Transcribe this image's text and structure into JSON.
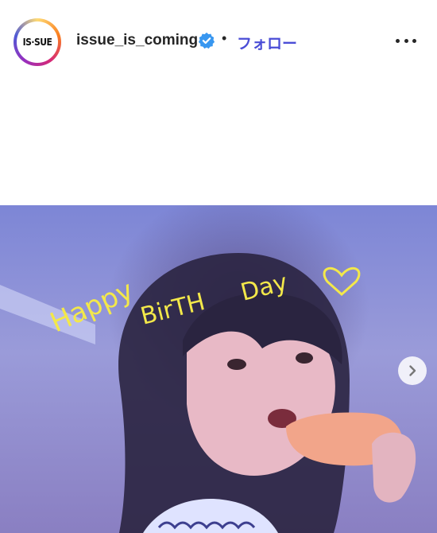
{
  "post": {
    "username": "issue_is_coming",
    "follow_label": "フォロー",
    "separator": "•",
    "avatar_text": "IS·SUE"
  },
  "image": {
    "handwritten_text": "Happy BirTH Day ♡",
    "description_colors": {
      "background": "#8f93d6",
      "text": "#f3e84a"
    }
  },
  "icons": {
    "verified": "verified-badge-icon",
    "more": "more-options-icon",
    "next": "chevron-right-icon"
  }
}
